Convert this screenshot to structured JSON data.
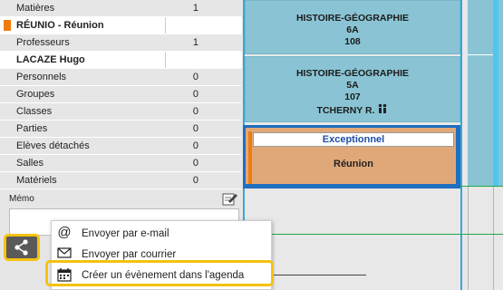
{
  "left_panel": {
    "rows": [
      {
        "label": "Matières",
        "count": "1"
      },
      {
        "label": "RÉUNIO - Réunion",
        "count": ""
      },
      {
        "label": "Professeurs",
        "count": "1"
      },
      {
        "label": "LACAZE Hugo",
        "count": ""
      },
      {
        "label": "Personnels",
        "count": "0"
      },
      {
        "label": "Groupes",
        "count": "0"
      },
      {
        "label": "Classes",
        "count": "0"
      },
      {
        "label": "Parties",
        "count": "0"
      },
      {
        "label": "Elèves détachés",
        "count": "0"
      },
      {
        "label": "Salles",
        "count": "0"
      },
      {
        "label": "Matériels",
        "count": "0"
      }
    ],
    "memo_label": "Mémo"
  },
  "timetable": {
    "course1": {
      "subject": "HISTOIRE-GÉOGRAPHIE",
      "class": "6A",
      "room": "108"
    },
    "course2": {
      "subject": "HISTOIRE-GÉOGRAPHIE",
      "class": "5A",
      "room": "107",
      "teacher": "TCHERNY R."
    },
    "event": {
      "title": "Exceptionnel",
      "text": "Réunion"
    }
  },
  "share_menu": {
    "items": [
      {
        "label": "Envoyer par e-mail",
        "icon": "at-icon"
      },
      {
        "label": "Envoyer par courrier",
        "icon": "envelope-icon"
      },
      {
        "label": "Créer un évènement dans l'agenda",
        "icon": "calendar-icon"
      }
    ]
  },
  "colors": {
    "accent": "#f5c20e",
    "course_bg": "#8ac4d4",
    "event_bg": "#e0a878",
    "event_border": "#1f6ec0",
    "orange": "#f07c0c"
  }
}
